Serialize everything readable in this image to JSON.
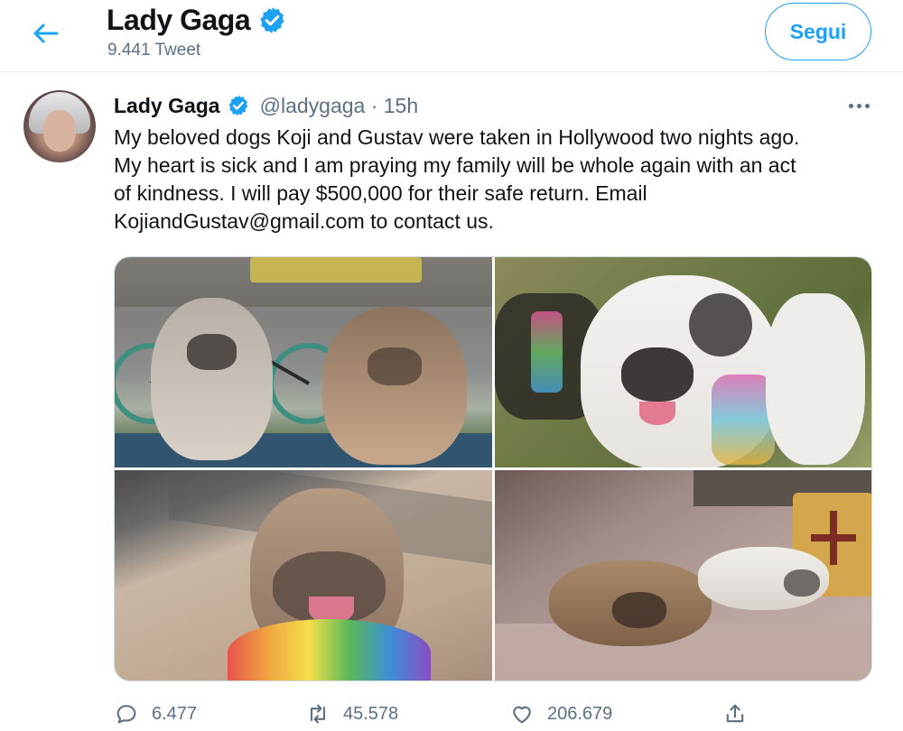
{
  "header": {
    "back_icon": "arrow-left-icon",
    "name": "Lady Gaga",
    "verified_icon": "verified-badge-icon",
    "tweet_count": "9.441 Tweet",
    "follow_label": "Segui"
  },
  "tweet": {
    "author_name": "Lady Gaga",
    "handle_time": "@ladygaga · 15h",
    "more_icon": "more-dots-icon",
    "text_lines": [
      "My beloved dogs Koji and Gustav were taken in Hollywood two nights ago.",
      "My heart is sick and I am praying my family will be whole again with an act",
      "of kindness. I will pay $500,000 for their safe return. Email",
      "KojiandGustav@gmail.com to contact us."
    ],
    "media_count_images": 4
  },
  "actions": {
    "reply_count": "6.477",
    "retweet_count": "45.578",
    "like_count": "206.679"
  },
  "colors": {
    "accent": "#1da1f2",
    "secondary_text": "#5b7083",
    "primary_text": "#0f1419"
  }
}
